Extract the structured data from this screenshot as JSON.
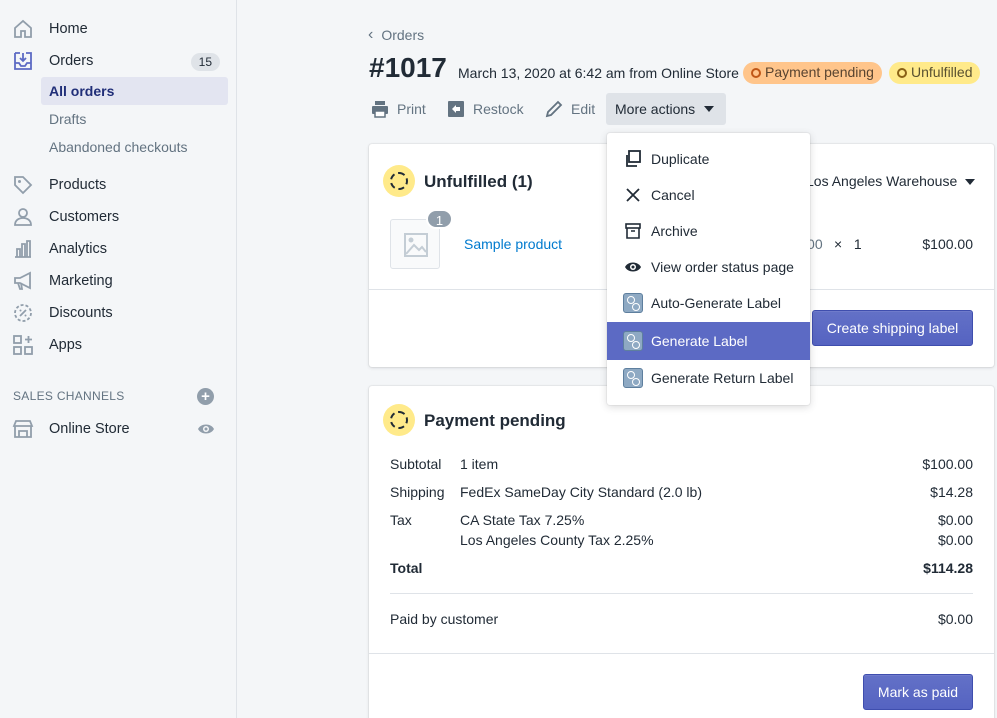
{
  "sidebar": {
    "items": [
      {
        "label": "Home",
        "icon": "home-icon"
      },
      {
        "label": "Orders",
        "icon": "orders-icon",
        "badge": "15"
      },
      {
        "label": "Products",
        "icon": "tag-icon"
      },
      {
        "label": "Customers",
        "icon": "person-icon"
      },
      {
        "label": "Analytics",
        "icon": "bar-chart-icon"
      },
      {
        "label": "Marketing",
        "icon": "megaphone-icon"
      },
      {
        "label": "Discounts",
        "icon": "discount-icon"
      },
      {
        "label": "Apps",
        "icon": "apps-icon"
      }
    ],
    "order_subitems": [
      "All orders",
      "Drafts",
      "Abandoned checkouts"
    ],
    "sales_channels_title": "SALES CHANNELS",
    "online_store": "Online Store"
  },
  "header": {
    "breadcrumb": "Orders",
    "order_number": "#1017",
    "order_meta": "March 13, 2020 at 6:42 am from Online Store",
    "payment_badge": "Payment pending",
    "fulfillment_badge": "Unfulfilled",
    "actions": {
      "print": "Print",
      "restock": "Restock",
      "edit": "Edit",
      "more": "More actions"
    }
  },
  "fulfillment": {
    "title": "Unfulfilled (1)",
    "location": "Los Angeles Warehouse",
    "product_name": "Sample product",
    "quantity_badge": "1",
    "unit_price": "$100.00",
    "times": "×",
    "quantity": "1",
    "line_total": "$100.00",
    "button": "Create shipping label"
  },
  "payment": {
    "title": "Payment pending",
    "rows": [
      {
        "label": "Subtotal",
        "desc": "1 item",
        "value": "$100.00"
      },
      {
        "label": "Shipping",
        "desc": "FedEx SameDay City Standard (2.0 lb)",
        "value": "$14.28"
      },
      {
        "label": "Tax",
        "desc": "CA State Tax 7.25%",
        "value": "$0.00"
      },
      {
        "label": "",
        "desc": "Los Angeles County Tax 2.25%",
        "value": "$0.00"
      }
    ],
    "total_label": "Total",
    "total_value": "$114.28",
    "paid_label": "Paid by customer",
    "paid_value": "$0.00",
    "button": "Mark as paid"
  },
  "dropdown": {
    "items": [
      {
        "label": "Duplicate",
        "icon": "duplicate-icon"
      },
      {
        "label": "Cancel",
        "icon": "close-icon"
      },
      {
        "label": "Archive",
        "icon": "archive-icon"
      },
      {
        "label": "View order status page",
        "icon": "eye-icon"
      },
      {
        "label": "Auto-Generate Label",
        "icon": "app-icon"
      },
      {
        "label": "Generate Label",
        "icon": "app-icon",
        "highlighted": true
      },
      {
        "label": "Generate Return Label",
        "icon": "app-icon"
      }
    ]
  },
  "colors": {
    "accent": "#5c6ac4",
    "link": "#007ace",
    "payment_badge_bg": "#ffc58b",
    "fulfillment_badge_bg": "#ffea8a"
  }
}
